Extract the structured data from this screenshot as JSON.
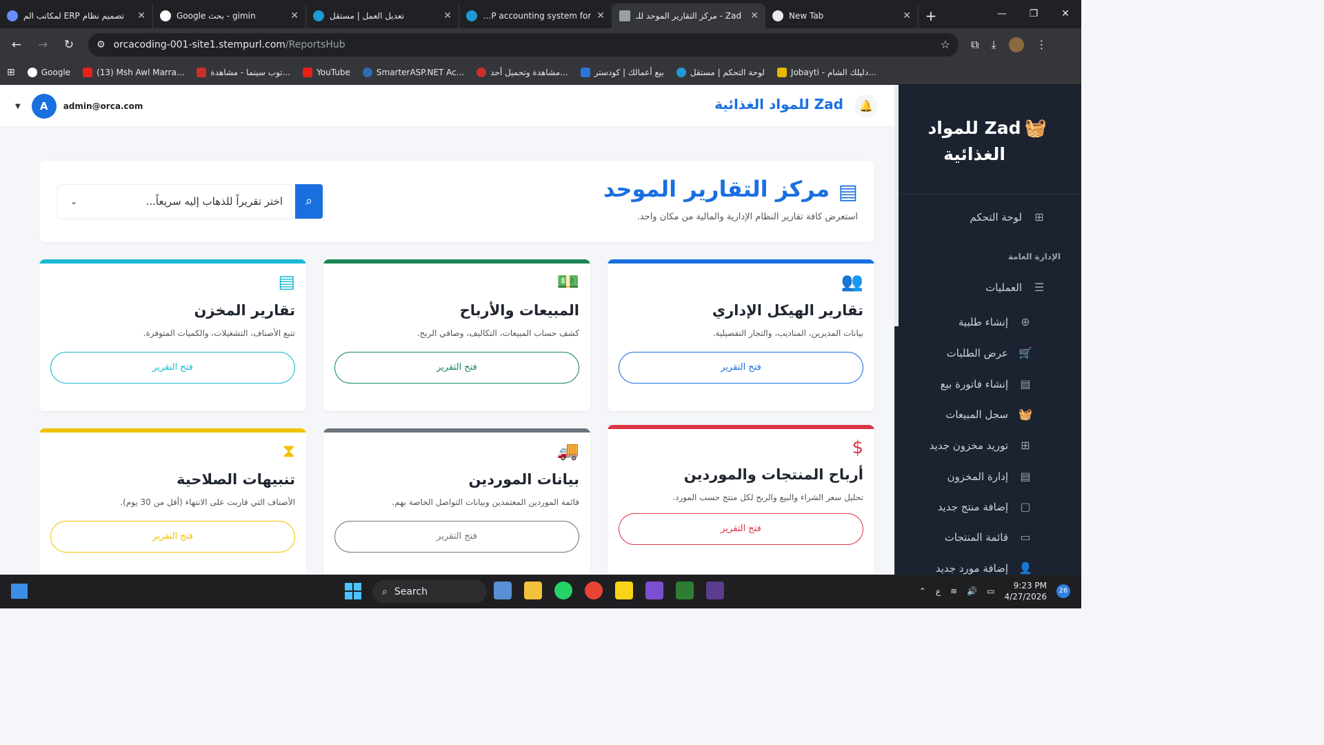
{
  "browser": {
    "tabs": [
      {
        "title": "تصميم نظام ERP لمكاتب الم",
        "color": "#6b8cff"
      },
      {
        "title": "gimin - بحث Google",
        "color": "#ffffff"
      },
      {
        "title": "تعديل العمل | مستقل",
        "color": "#1e9ad6"
      },
      {
        "title": "ERP accounting system for",
        "color": "#1e9ad6"
      },
      {
        "title": "Zad - مركز التقارير الموحد للـ",
        "color": "#9aa0a6"
      },
      {
        "title": "New Tab",
        "color": "#e8eaed"
      }
    ],
    "url_host": "orcacoding-001-site1.stempurl.com",
    "url_path": "/ReportsHub",
    "bookmarks": [
      {
        "label": "Google",
        "color": "#ffffff"
      },
      {
        "label": "(13) Msh Awl Marra...",
        "color": "#e62117"
      },
      {
        "label": "توب سينما - مشاهدة...",
        "color": "#c9302c"
      },
      {
        "label": "YouTube",
        "color": "#e62117"
      },
      {
        "label": "SmarterASP.NET Ac...",
        "color": "#2d6db5"
      },
      {
        "label": "مشاهدة وتحميل أحد...",
        "color": "#c9302c"
      },
      {
        "label": "بيع أعمالك | كودستر",
        "color": "#2b74d8"
      },
      {
        "label": "لوحة التحكم | مستقل",
        "color": "#1e9ad6"
      },
      {
        "label": "Jobayti - دليلك الشام...",
        "color": "#e6b800"
      }
    ]
  },
  "topbar": {
    "user_email": "admin@orca.com",
    "avatar_letter": "A",
    "brand": "Zad للمواد الغذائية"
  },
  "sidebar": {
    "brand": "Zad للمواد الغذائية",
    "dashboard": "لوحة التحكم",
    "section_header": "الإدارة العامة",
    "operations": "العمليات",
    "items": [
      {
        "label": "إنشاء طلبية",
        "icon": "plus-circle-icon"
      },
      {
        "label": "عرض الطلبات",
        "icon": "cart-icon"
      },
      {
        "label": "إنشاء فاتورة بيع",
        "icon": "document-icon"
      },
      {
        "label": "سجل المبيعات",
        "icon": "basket-icon"
      },
      {
        "label": "توريد مخزون جديد",
        "icon": "plus-square-icon"
      },
      {
        "label": "إدارة المخزون",
        "icon": "warehouse-icon"
      },
      {
        "label": "إضافة منتج جديد",
        "icon": "box-icon"
      },
      {
        "label": "قائمة المنتجات",
        "icon": "archive-icon"
      },
      {
        "label": "إضافة مورد جديد",
        "icon": "user-plus-icon"
      }
    ]
  },
  "hero": {
    "title": "مركز التقارير الموحد",
    "subtitle": "استعرض كافة تقارير النظام الإدارية والمالية من مكان واحد.",
    "search_placeholder": "اختر تقريراً للذهاب إليه سريعاً..."
  },
  "cards": [
    {
      "title": "تقارير الهيكل الإداري",
      "desc": "بيانات المديرين، المناديب، والتجار التفصيلية.",
      "button": "فتح التقرير",
      "color": "#1a6fe0",
      "icon": "users-cog-icon"
    },
    {
      "title": "المبيعات والأرباح",
      "desc": "كشف حساب المبيعات، التكاليف، وصافي الربح.",
      "button": "فتح التقرير",
      "color": "#198754",
      "icon": "money-bill-icon"
    },
    {
      "title": "تقارير المخزن",
      "desc": "تتبع الأصناف، التشغيلات، والكميات المتوفرة.",
      "button": "فتح التقرير",
      "color": "#17b8d4",
      "icon": "warehouse-icon"
    },
    {
      "title": "أرباح المنتجات والموردين",
      "desc": "تحليل سعر الشراء والبيع والربح لكل منتج حسب المورد.",
      "button": "فتح التقرير",
      "color": "#dc3545",
      "icon": "hand-dollar-icon"
    },
    {
      "title": "بيانات الموردين",
      "desc": "قائمة الموردين المعتمدين وبيانات التواصل الخاصة بهم.",
      "button": "فتح التقرير",
      "color": "#6c757d",
      "icon": "truck-icon"
    },
    {
      "title": "تنبيهات الصلاحية",
      "desc": "الأصناف التي قاربت على الانتهاء (أقل من 30 يوم).",
      "button": "فتح التقرير",
      "color": "#f2c200",
      "icon": "hourglass-icon"
    }
  ],
  "taskbar": {
    "search": "Search",
    "time": "9:23 PM",
    "date": "4/27/2026",
    "badge": "26",
    "lang": "ع"
  }
}
